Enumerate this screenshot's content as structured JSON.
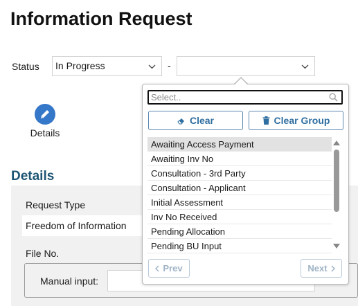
{
  "page": {
    "title": "Information Request"
  },
  "status": {
    "label": "Status",
    "selected": "In Progress",
    "separator": "-",
    "sub_selected": ""
  },
  "details_link": {
    "label": "Details",
    "icon": "pencil-icon"
  },
  "section": {
    "heading": "Details"
  },
  "form": {
    "request_type_label": "Request Type",
    "request_type_value": "Freedom of Information",
    "file_no_label": "File No.",
    "manual_input_label": "Manual input:",
    "manual_input_value": ""
  },
  "dropdown": {
    "search_placeholder": "Select..",
    "clear_label": "Clear",
    "clear_group_label": "Clear Group",
    "options": [
      "Awaiting Access Payment",
      "Awaiting Inv No",
      "Consultation - 3rd Party",
      "Consultation - Applicant",
      "Initial Assessment",
      "Inv No Received",
      "Pending Allocation",
      "Pending BU Input"
    ],
    "highlighted_index": 0,
    "prev_label": "Prev",
    "next_label": "Next"
  },
  "colors": {
    "accent": "#3577c9",
    "heading": "#1e5574",
    "button_text": "#2f6ea0",
    "panel_bg": "#f1f1f1"
  }
}
